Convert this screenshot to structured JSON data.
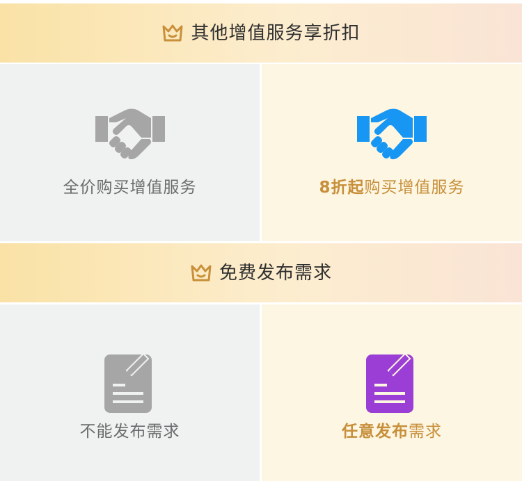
{
  "sections": [
    {
      "title": "其他增值服务享折扣",
      "cards": [
        {
          "label": "全价购买增值服务",
          "icon": "handshake-icon",
          "icon_color": "#a6a6a6"
        },
        {
          "label_prefix": "8折起",
          "label_suffix": "购买增值服务",
          "icon": "handshake-icon",
          "icon_color": "#1797f3"
        }
      ]
    },
    {
      "title": "免费发布需求",
      "cards": [
        {
          "label": "不能发布需求",
          "icon": "document-edit-icon",
          "icon_color": "#a6a6a6"
        },
        {
          "label_prefix": "任意发布",
          "label_suffix": "需求",
          "icon": "document-edit-icon",
          "icon_color": "#9b3ed6"
        }
      ]
    }
  ],
  "colors": {
    "crown": "#c8903a",
    "label_gray": "#6a6d6d",
    "label_gold": "#c78f3a",
    "card_left_bg": "#f0f1f1",
    "card_right_bg": "#fdf6e2"
  }
}
